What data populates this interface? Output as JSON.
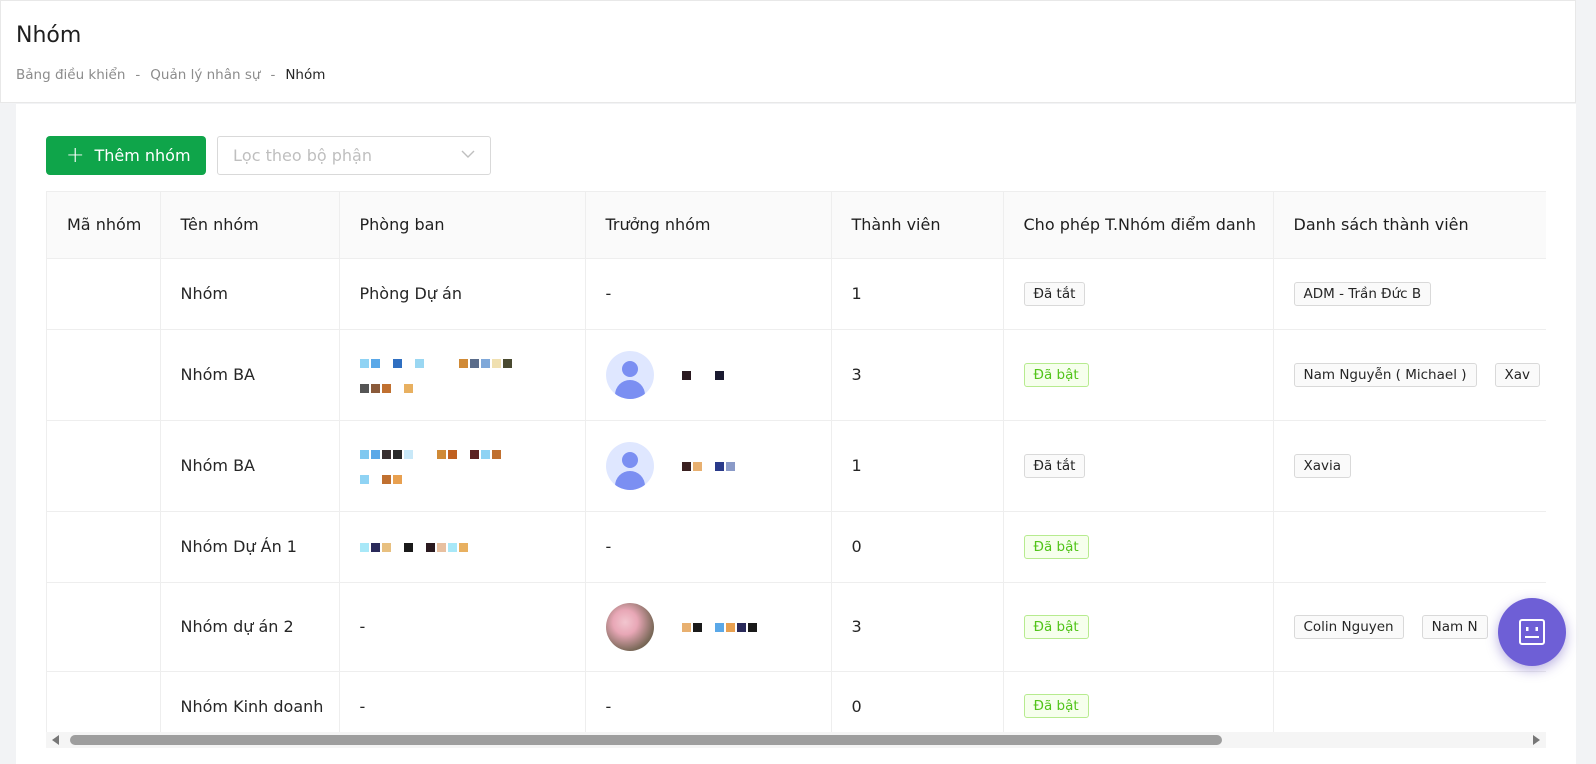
{
  "header": {
    "title": "Nhóm",
    "breadcrumb": [
      "Bảng điều khiển",
      "Quản lý nhân sự",
      "Nhóm"
    ],
    "separator": "-"
  },
  "toolbar": {
    "add_label": "Thêm nhóm",
    "filter_placeholder": "Lọc theo bộ phận"
  },
  "table": {
    "columns": [
      "Mã nhóm",
      "Tên nhóm",
      "Phòng ban",
      "Trưởng nhóm",
      "Thành viên",
      "Cho phép T.Nhóm điểm danh",
      "Danh sách thành viên"
    ],
    "rows": [
      {
        "code": "",
        "name": "Nhóm",
        "department": "Phòng Dự án",
        "leader": "-",
        "members": "1",
        "attendance": "Đã tắt",
        "member_list": [
          "ADM - Trần Đức B"
        ]
      },
      {
        "code": "",
        "name": "Nhóm BA",
        "department": "",
        "leader": "",
        "members": "3",
        "attendance": "Đã bật",
        "member_list": [
          "Nam Nguyễn ( Michael )",
          "Xav"
        ]
      },
      {
        "code": "",
        "name": "Nhóm BA",
        "department": "",
        "leader": "",
        "members": "1",
        "attendance": "Đã tắt",
        "member_list": [
          "Xavia"
        ]
      },
      {
        "code": "",
        "name": "Nhóm Dự Án 1",
        "department": "",
        "leader": "-",
        "members": "0",
        "attendance": "Đã bật",
        "member_list": []
      },
      {
        "code": "",
        "name": "Nhóm dự án 2",
        "department": "-",
        "leader": "",
        "members": "3",
        "attendance": "Đã bật",
        "member_list": [
          "Colin Nguyen",
          "Nam N"
        ]
      },
      {
        "code": "",
        "name": "Nhóm Kinh doanh",
        "department": "-",
        "leader": "-",
        "members": "0",
        "attendance": "Đã bật",
        "member_list": []
      }
    ]
  },
  "colors": {
    "primary_green": "#0fa54a",
    "tag_on": "#52c41a",
    "fab": "#6e5fd6"
  },
  "icons": [
    "plus-icon",
    "chevron-down-icon",
    "user-avatar-icon",
    "chatbot-icon"
  ]
}
